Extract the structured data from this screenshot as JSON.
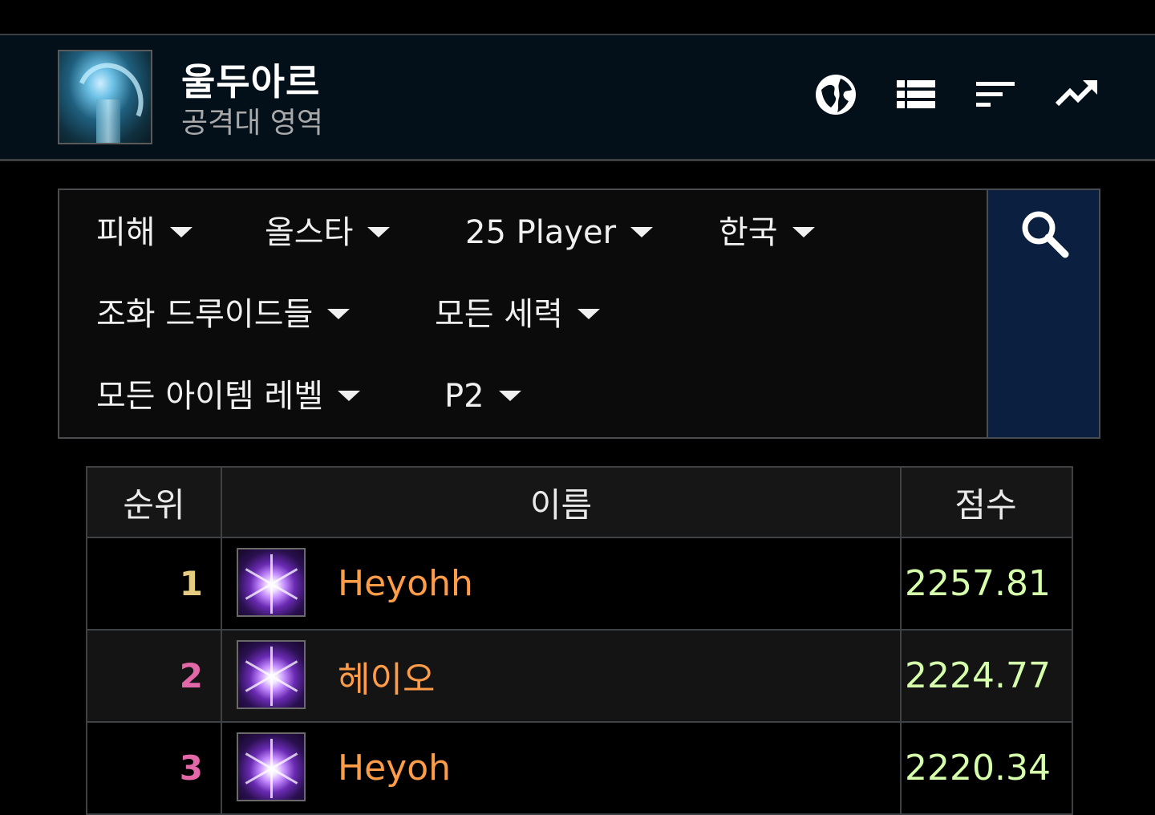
{
  "header": {
    "title": "울두아르",
    "subtitle": "공격대 영역",
    "icons": [
      "globe-icon",
      "list-icon",
      "sort-icon",
      "trending-up-icon"
    ]
  },
  "filters": {
    "metric": "피해",
    "difficulty": "올스타",
    "size": "25 Player",
    "region": "한국",
    "spec": "조화 드루이드들",
    "faction": "모든 세력",
    "item_level": "모든 아이템 레벨",
    "partition": "P2"
  },
  "table": {
    "headers": {
      "rank": "순위",
      "name": "이름",
      "score": "점수"
    },
    "rows": [
      {
        "rank": "1",
        "name": "Heyohh",
        "score": "2257.81",
        "rank_color": "#e5cc80",
        "spec_icon": "balance-druid-icon"
      },
      {
        "rank": "2",
        "name": "헤이오",
        "score": "2224.77",
        "rank_color": "#e268a8",
        "spec_icon": "balance-druid-icon"
      },
      {
        "rank": "3",
        "name": "Heyoh",
        "score": "2220.34",
        "rank_color": "#e268a8",
        "spec_icon": "balance-druid-icon"
      }
    ]
  },
  "colors": {
    "header_bg": "#03101a",
    "search_bg": "#0b2040",
    "name_color": "#ff9c48",
    "score_color": "#d6ffab"
  }
}
